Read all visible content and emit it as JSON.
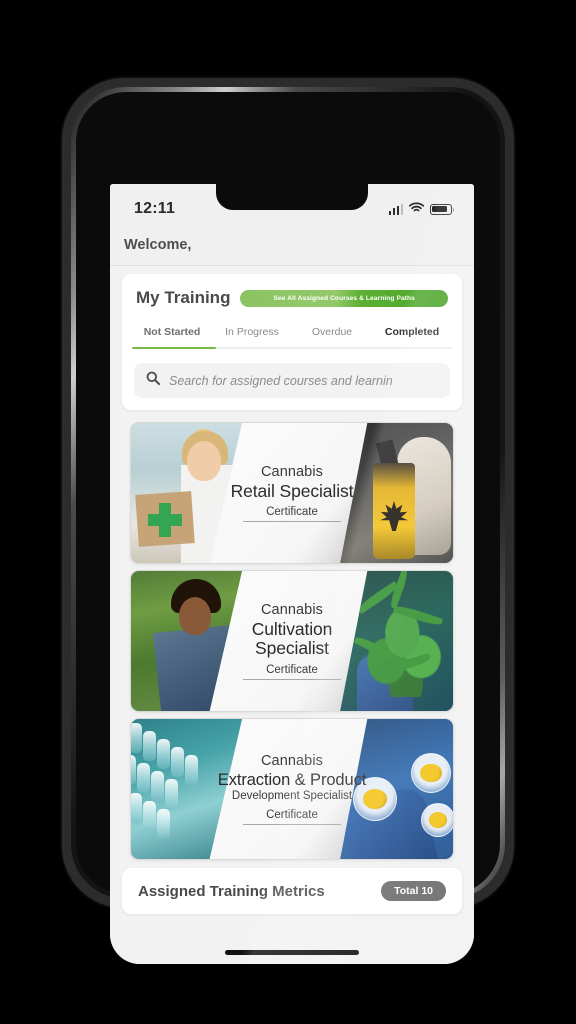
{
  "status_bar": {
    "time": "12:11",
    "signal_icon": "signal-bars-icon",
    "wifi_icon": "wifi-icon",
    "battery_icon": "battery-icon"
  },
  "header": {
    "welcome": "Welcome,"
  },
  "training": {
    "title": "My Training",
    "see_all_label": "See All Assigned Courses & Learning Paths",
    "see_all_color": "#76bb4a",
    "tabs": [
      {
        "label": "Not Started",
        "state": "active"
      },
      {
        "label": "In Progress",
        "state": "default"
      },
      {
        "label": "Overdue",
        "state": "default"
      },
      {
        "label": "Completed",
        "state": "selected"
      }
    ],
    "active_tab_indicator_color": "#76bb4a"
  },
  "search": {
    "icon": "search-icon",
    "value": "",
    "placeholder": "Search for assigned courses and learnin"
  },
  "courses": [
    {
      "pre_title": "Cannabis",
      "title": "Retail Specialist",
      "subtitle": "",
      "badge": "Certificate",
      "left_image": "pharmacist-with-paper-bag-green-cross-photo",
      "right_image": "hand-holding-amber-dropper-bottle-cannabis-leaf-photo"
    },
    {
      "pre_title": "Cannabis",
      "title": "Cultivation",
      "subtitle": "Specialist",
      "badge": "Certificate",
      "left_image": "woman-in-green-field-photo",
      "right_image": "cannabis-plant-held-by-blue-glove-photo"
    },
    {
      "pre_title": "Cannabis",
      "title": "Extraction & Product",
      "subtitle": "Development Specialist",
      "badge": "Certificate",
      "left_image": "rows-of-glass-vials-photo",
      "right_image": "gloved-hand-with-extract-dishes-photo"
    }
  ],
  "metrics": {
    "title": "Assigned Training Metrics",
    "badge": "Total 10"
  }
}
